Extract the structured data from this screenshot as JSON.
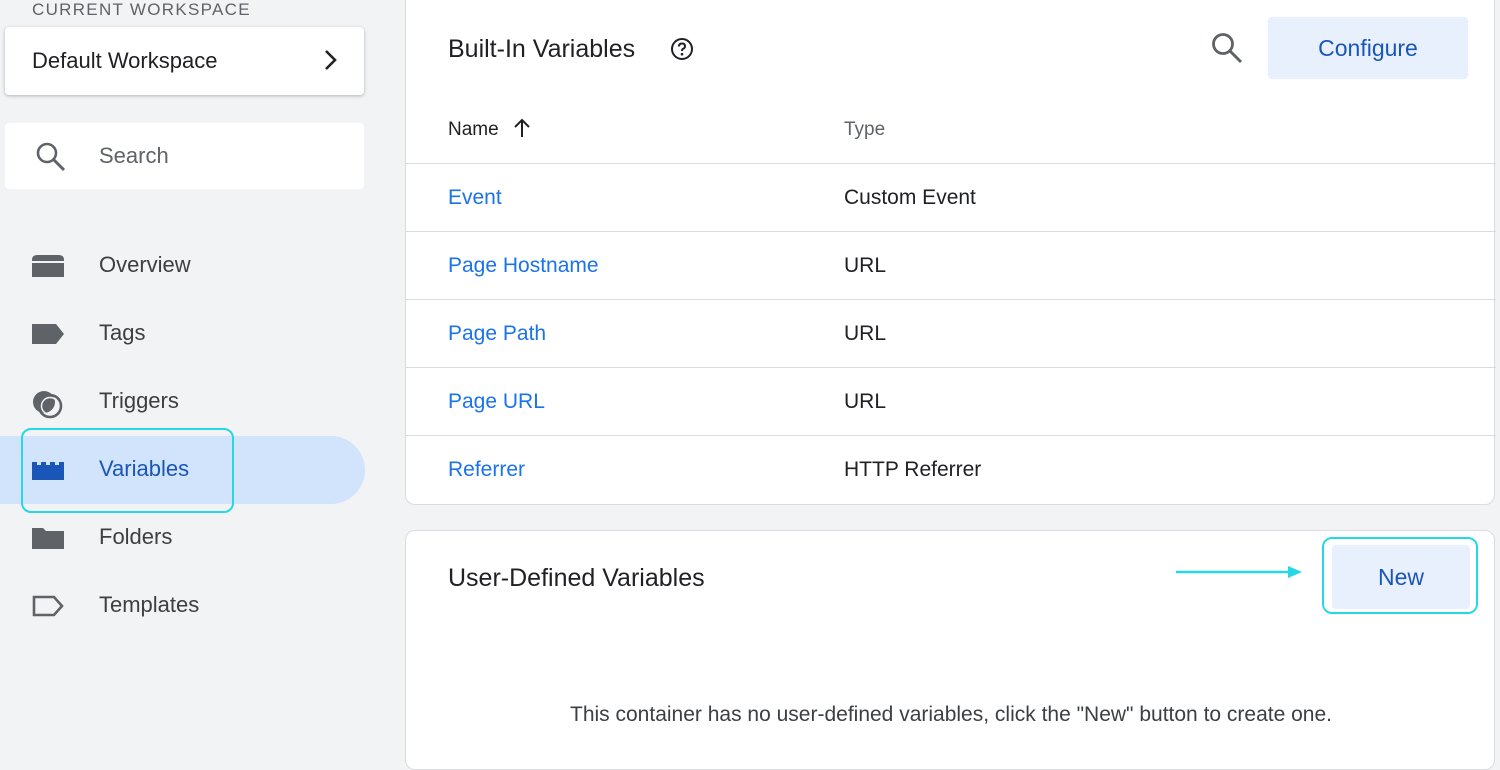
{
  "sidebar": {
    "workspace_label": "CURRENT WORKSPACE",
    "workspace_name": "Default Workspace",
    "search_placeholder": "Search",
    "items": [
      {
        "label": "Overview",
        "icon": "overview-icon"
      },
      {
        "label": "Tags",
        "icon": "tag-icon"
      },
      {
        "label": "Triggers",
        "icon": "trigger-icon"
      },
      {
        "label": "Variables",
        "icon": "variables-icon",
        "active": true
      },
      {
        "label": "Folders",
        "icon": "folder-icon"
      },
      {
        "label": "Templates",
        "icon": "template-icon"
      }
    ]
  },
  "builtin": {
    "title": "Built-In Variables",
    "configure_label": "Configure",
    "columns": {
      "name": "Name",
      "type": "Type"
    },
    "rows": [
      {
        "name": "Event",
        "type": "Custom Event"
      },
      {
        "name": "Page Hostname",
        "type": "URL"
      },
      {
        "name": "Page Path",
        "type": "URL"
      },
      {
        "name": "Page URL",
        "type": "URL"
      },
      {
        "name": "Referrer",
        "type": "HTTP Referrer"
      }
    ]
  },
  "userdefined": {
    "title": "User-Defined Variables",
    "new_label": "New",
    "empty_message": "This container has no user-defined variables, click the \"New\" button to create one."
  },
  "colors": {
    "accent": "#1a73e8",
    "active_bg": "#d2e3fc",
    "highlight": "#26d7e6"
  }
}
